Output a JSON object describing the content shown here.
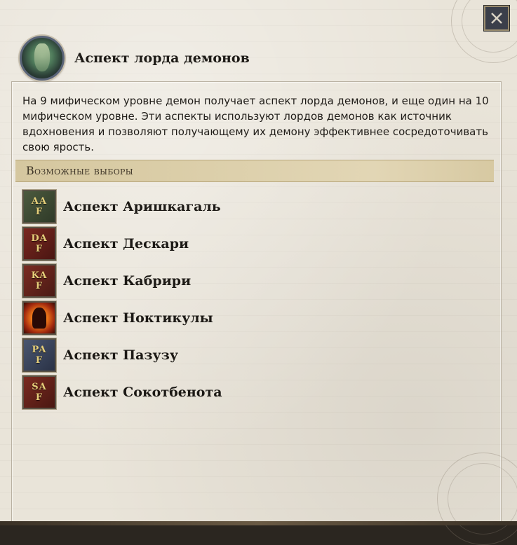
{
  "window": {
    "close_icon": "close-icon"
  },
  "header": {
    "portrait_icon": "demon-lord-portrait",
    "title": "Аспект лорда демонов"
  },
  "description": "На 9 мифическом уровне демон получает аспект лорда демонов, и еще один на 10 мифическом уровне. Эти аспекты используют лордов демонов как источник вдохновения и позволяют получающему их демону эффективнее сосредоточивать свою ярость.",
  "section": {
    "title": "Возможные выборы"
  },
  "choices": [
    {
      "label": "Аспект Аришкагаль",
      "icon": "aspect-arishkagal-icon",
      "glyph_top": "AA",
      "glyph_bottom": "F"
    },
    {
      "label": "Аспект Дескари",
      "icon": "aspect-deskari-icon",
      "glyph_top": "DA",
      "glyph_bottom": "F"
    },
    {
      "label": "Аспект Кабрири",
      "icon": "aspect-kabriri-icon",
      "glyph_top": "KA",
      "glyph_bottom": "F"
    },
    {
      "label": "Аспект Ноктикулы",
      "icon": "aspect-nocticula-icon",
      "glyph_top": "",
      "glyph_bottom": ""
    },
    {
      "label": "Аспект Пазузу",
      "icon": "aspect-pazuzu-icon",
      "glyph_top": "PA",
      "glyph_bottom": "F"
    },
    {
      "label": "Аспект Сокотбенота",
      "icon": "aspect-sokotbenot-icon",
      "glyph_top": "SA",
      "glyph_bottom": "F"
    }
  ],
  "colors": {
    "parchment": "#e9e4d9",
    "section_header": "#dccfaa",
    "text": "#1e1b17",
    "icon_gold": "#e6cf7a"
  }
}
